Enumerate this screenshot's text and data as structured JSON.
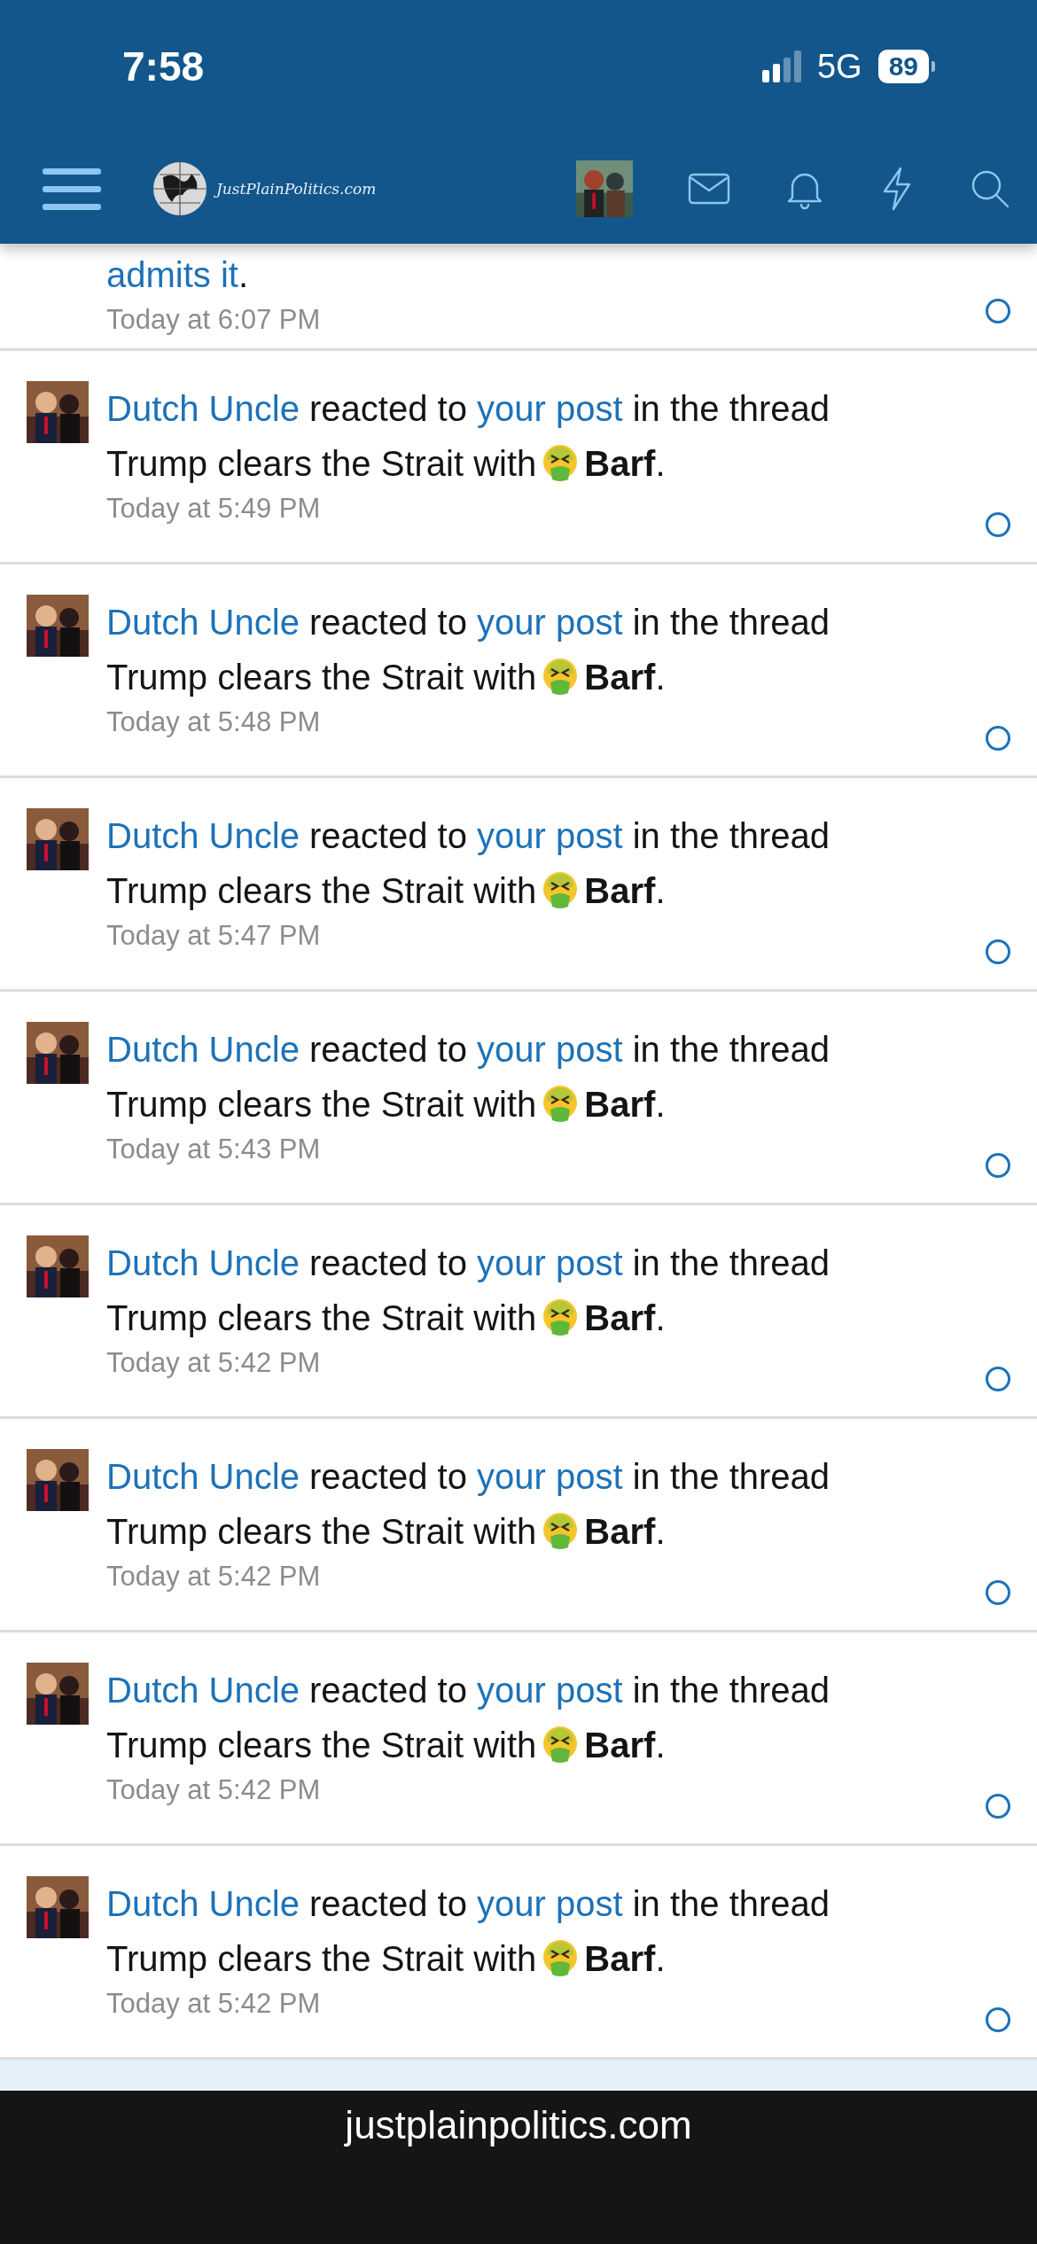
{
  "status_bar": {
    "time": "7:58",
    "network": "5G",
    "battery": "89"
  },
  "nav": {
    "logo_text": "JustPlainPolitics.com"
  },
  "partial_alert": {
    "link": "admits it",
    "end": ".",
    "time": "Today at 6:07 PM",
    "unread": true
  },
  "alerts": [
    {
      "user": "Dutch Uncle",
      "verb": "reacted to",
      "link": "your post",
      "middle": "in the thread",
      "thread": "Trump clears the Strait with",
      "reaction": "Barf",
      "end": ".",
      "time": "Today at 5:49 PM",
      "unread": true
    },
    {
      "user": "Dutch Uncle",
      "verb": "reacted to",
      "link": "your post",
      "middle": "in the thread",
      "thread": "Trump clears the Strait with",
      "reaction": "Barf",
      "end": ".",
      "time": "Today at 5:48 PM",
      "unread": true
    },
    {
      "user": "Dutch Uncle",
      "verb": "reacted to",
      "link": "your post",
      "middle": "in the thread",
      "thread": "Trump clears the Strait with",
      "reaction": "Barf",
      "end": ".",
      "time": "Today at 5:47 PM",
      "unread": true
    },
    {
      "user": "Dutch Uncle",
      "verb": "reacted to",
      "link": "your post",
      "middle": "in the thread",
      "thread": "Trump clears the Strait with",
      "reaction": "Barf",
      "end": ".",
      "time": "Today at 5:43 PM",
      "unread": true
    },
    {
      "user": "Dutch Uncle",
      "verb": "reacted to",
      "link": "your post",
      "middle": "in the thread",
      "thread": "Trump clears the Strait with",
      "reaction": "Barf",
      "end": ".",
      "time": "Today at 5:42 PM",
      "unread": true
    },
    {
      "user": "Dutch Uncle",
      "verb": "reacted to",
      "link": "your post",
      "middle": "in the thread",
      "thread": "Trump clears the Strait with",
      "reaction": "Barf",
      "end": ".",
      "time": "Today at 5:42 PM",
      "unread": true
    },
    {
      "user": "Dutch Uncle",
      "verb": "reacted to",
      "link": "your post",
      "middle": "in the thread",
      "thread": "Trump clears the Strait with",
      "reaction": "Barf",
      "end": ".",
      "time": "Today at 5:42 PM",
      "unread": true
    },
    {
      "user": "Dutch Uncle",
      "verb": "reacted to",
      "link": "your post",
      "middle": "in the thread",
      "thread": "Trump clears the Strait with",
      "reaction": "Barf",
      "end": ".",
      "time": "Today at 5:42 PM",
      "unread": true
    }
  ],
  "footer": {
    "domain": "justplainpolitics.com"
  }
}
